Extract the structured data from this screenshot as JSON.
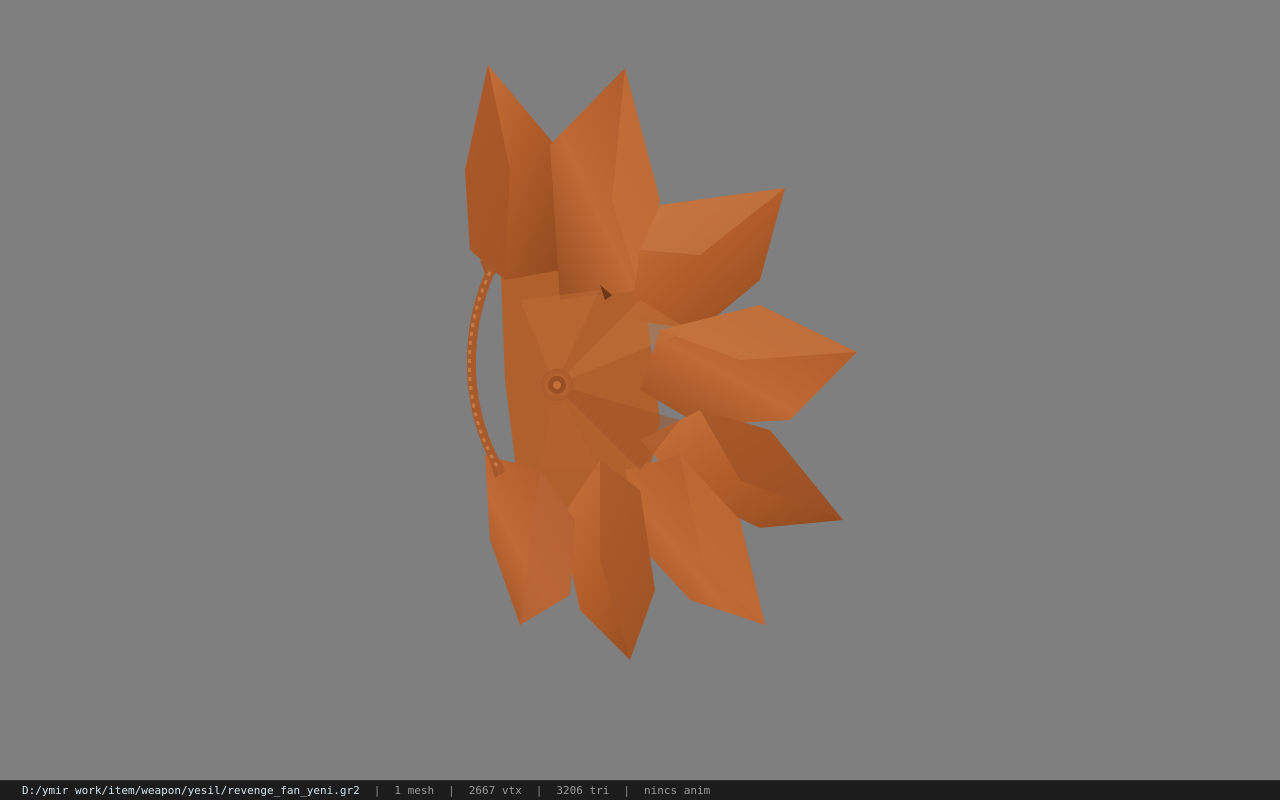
{
  "viewer": {
    "background_color": "#7f7f7f",
    "model_color": "#b8612e"
  },
  "status_bar": {
    "file_path": "D:/ymir work/item/weapon/yesil/revenge_fan_yeni.gr2",
    "separator": "|",
    "mesh_count": "1 mesh",
    "vertex_count": "2667 vtx",
    "triangle_count": "3206 tri",
    "anim_status": "nincs anim"
  }
}
